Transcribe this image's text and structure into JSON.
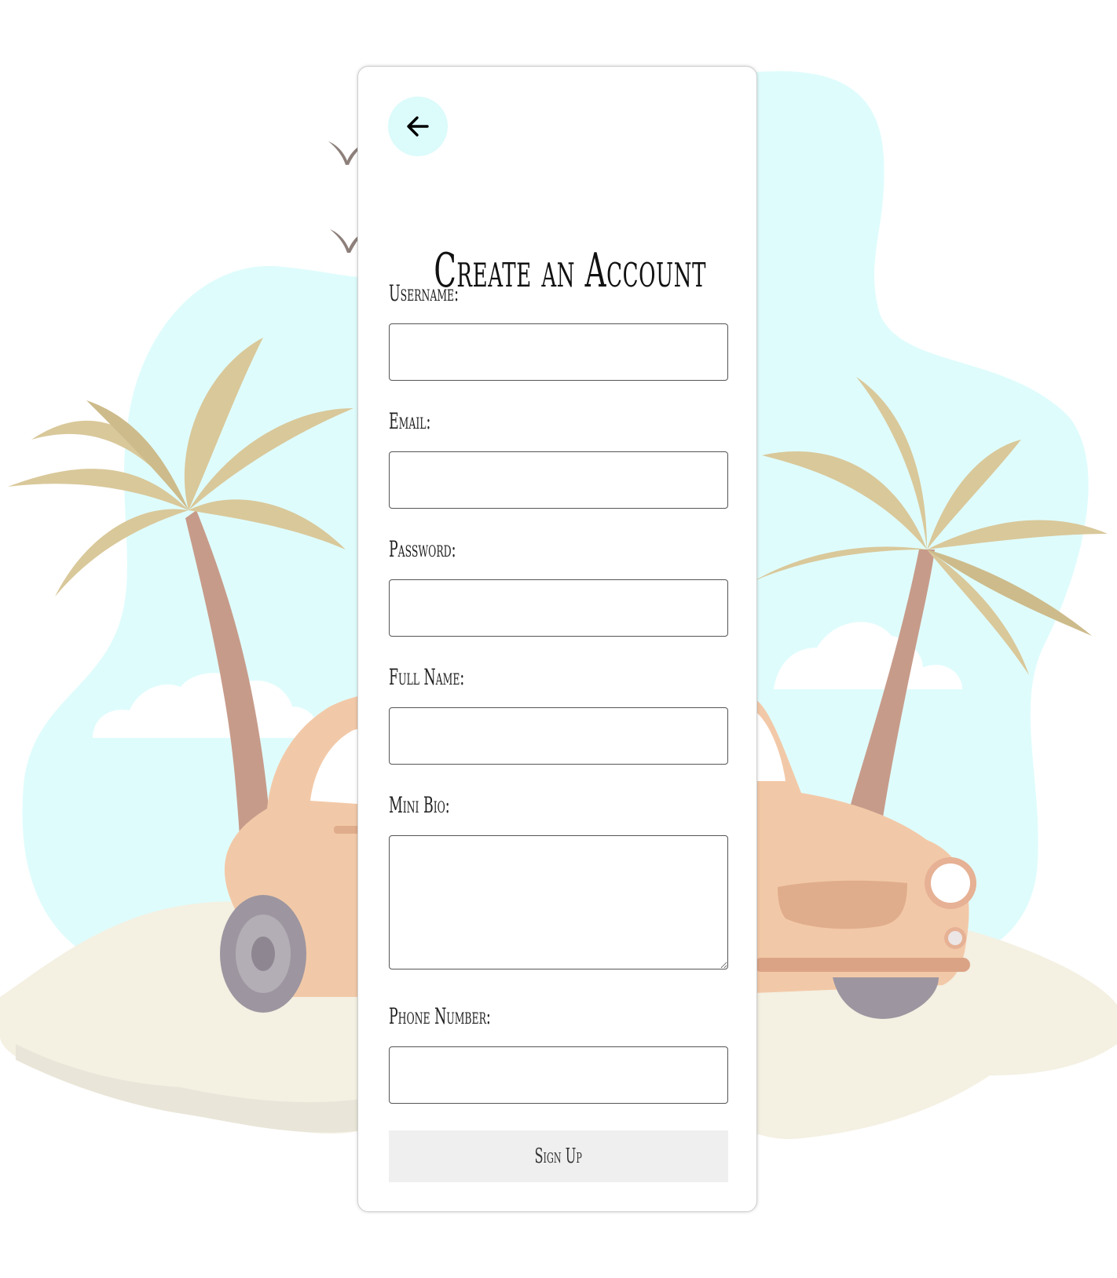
{
  "form": {
    "title": "Create an Account",
    "back_icon": "arrow-left-icon",
    "fields": [
      {
        "label": "Username:",
        "type": "text",
        "value": "",
        "placeholder": ""
      },
      {
        "label": "Email:",
        "type": "email",
        "value": "",
        "placeholder": ""
      },
      {
        "label": "Password:",
        "type": "password",
        "value": "",
        "placeholder": ""
      },
      {
        "label": "Full Name:",
        "type": "text",
        "value": "",
        "placeholder": ""
      },
      {
        "label": "Mini Bio:",
        "type": "textarea",
        "value": "",
        "placeholder": ""
      },
      {
        "label": "Phone Number:",
        "type": "tel",
        "value": "",
        "placeholder": ""
      }
    ],
    "submit_label": "Sign Up"
  },
  "colors": {
    "back_button_bg": "#dcfbfb",
    "sky_blob": "#dffcfc",
    "palm_leaf": "#d9c89a",
    "palm_trunk": "#c79b8a",
    "car_body": "#f2c9a8",
    "sand": "#f4f0e2",
    "submit_bg": "#efefef"
  },
  "background": {
    "illustration": "beach-car-palm-trees-illustration"
  }
}
